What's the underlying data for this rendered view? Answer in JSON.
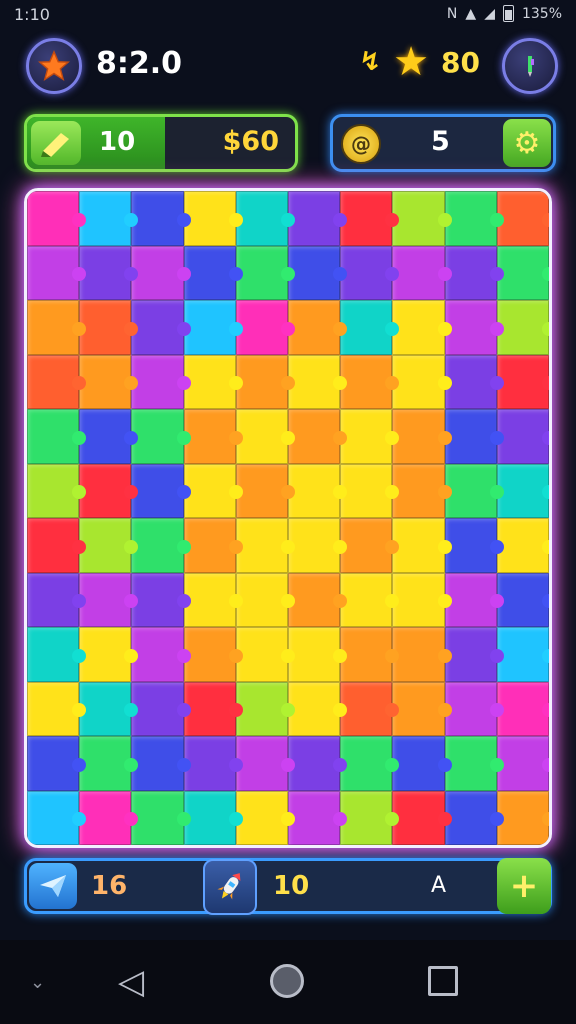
{
  "status_bar": {
    "time": "1:10",
    "battery": "135%",
    "signal_icon": "signal-icon",
    "wifi_icon": "wifi-icon",
    "nfc_icon": "nfc-icon"
  },
  "header": {
    "timer": "8:2.0",
    "score": "80",
    "level_icon": "star-icon",
    "bolt_icon": "bolt-icon",
    "menu_icon": "pencil-icon"
  },
  "hints_panel": {
    "count": "10",
    "money": "$60",
    "icon": "pencil-icon"
  },
  "coins_panel": {
    "count": "5",
    "icon": "coin-icon",
    "settings_icon": "gear-icon"
  },
  "bottom_bar": {
    "left_value": "16",
    "mid_value": "10",
    "right_value": "A",
    "send_icon": "paper-plane-icon",
    "rocket_icon": "rocket-icon",
    "add_icon": "plus-icon"
  },
  "nav": {
    "back_icon": "back-icon",
    "home_icon": "home-icon",
    "recents_icon": "recents-icon",
    "down_icon": "chevron-down-icon"
  },
  "colors": {
    "accent_green": "#7fe24a",
    "accent_blue": "#3a9cff",
    "board_glow": "#ff5fd0",
    "pieces": [
      "#ff2fb8",
      "#7b3fe4",
      "#ff9a1f",
      "#ffe21a",
      "#2fe06a",
      "#1fc4ff",
      "#ff2f3f",
      "#c23fe6",
      "#10d4c8",
      "#ff5f2f",
      "#3f4ee8",
      "#a8e62f"
    ]
  }
}
